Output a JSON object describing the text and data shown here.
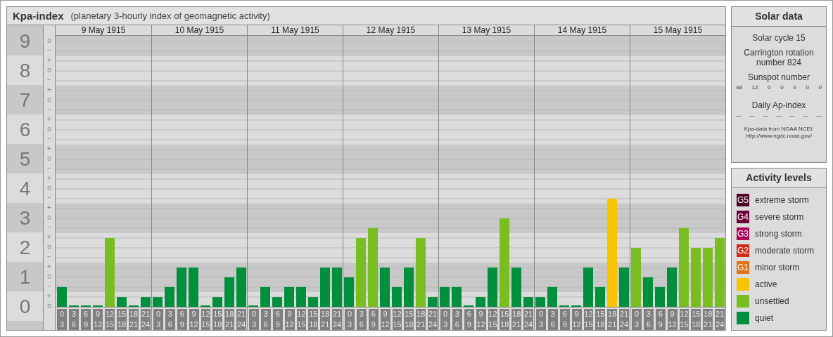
{
  "kp_panel": {
    "title": "Kpa-index",
    "subtitle": "(planetary 3-hourly index of geomagnetic activity)",
    "axis_marks": [
      [
        "o",
        "−"
      ],
      [
        "+",
        "o",
        "−"
      ],
      [
        "+",
        "o",
        "−"
      ],
      [
        "+",
        "o",
        "−"
      ],
      [
        "+",
        "o",
        "−"
      ],
      [
        "+",
        "o",
        "−"
      ],
      [
        "+",
        "o",
        "−"
      ],
      [
        "+",
        "o",
        "−"
      ],
      [
        "+",
        "o",
        "−"
      ],
      [
        "+",
        "o"
      ]
    ],
    "days": [
      {
        "label": "9 May 1915",
        "slots": [
          {
            "start": "0",
            "end": "3"
          },
          {
            "start": "3",
            "end": "6"
          },
          {
            "start": "6",
            "end": "9"
          },
          {
            "start": "9",
            "end": "12"
          },
          {
            "start": "12",
            "end": "15"
          },
          {
            "start": "15",
            "end": "18"
          },
          {
            "start": "18",
            "end": "21"
          },
          {
            "start": "21",
            "end": "24"
          }
        ]
      },
      {
        "label": "10 May 1915",
        "slots": [
          {
            "start": "0",
            "end": "3"
          },
          {
            "start": "3",
            "end": "6"
          },
          {
            "start": "6",
            "end": "9"
          },
          {
            "start": "9",
            "end": "12"
          },
          {
            "start": "12",
            "end": "15"
          },
          {
            "start": "15",
            "end": "18"
          },
          {
            "start": "18",
            "end": "21"
          },
          {
            "start": "21",
            "end": "24"
          }
        ]
      },
      {
        "label": "11 May 1915",
        "slots": [
          {
            "start": "0",
            "end": "3"
          },
          {
            "start": "3",
            "end": "6"
          },
          {
            "start": "6",
            "end": "9"
          },
          {
            "start": "9",
            "end": "12"
          },
          {
            "start": "12",
            "end": "15"
          },
          {
            "start": "15",
            "end": "18"
          },
          {
            "start": "18",
            "end": "21"
          },
          {
            "start": "21",
            "end": "24"
          }
        ]
      },
      {
        "label": "12 May 1915",
        "slots": [
          {
            "start": "0",
            "end": "3"
          },
          {
            "start": "3",
            "end": "6"
          },
          {
            "start": "6",
            "end": "9"
          },
          {
            "start": "9",
            "end": "12"
          },
          {
            "start": "12",
            "end": "15"
          },
          {
            "start": "15",
            "end": "18"
          },
          {
            "start": "18",
            "end": "21"
          },
          {
            "start": "21",
            "end": "24"
          }
        ]
      },
      {
        "label": "13 May 1915",
        "slots": [
          {
            "start": "0",
            "end": "3"
          },
          {
            "start": "3",
            "end": "6"
          },
          {
            "start": "6",
            "end": "9"
          },
          {
            "start": "9",
            "end": "12"
          },
          {
            "start": "12",
            "end": "15"
          },
          {
            "start": "15",
            "end": "18"
          },
          {
            "start": "18",
            "end": "21"
          },
          {
            "start": "21",
            "end": "24"
          }
        ]
      },
      {
        "label": "14 May 1915",
        "slots": [
          {
            "start": "0",
            "end": "3"
          },
          {
            "start": "3",
            "end": "6"
          },
          {
            "start": "6",
            "end": "9"
          },
          {
            "start": "9",
            "end": "12"
          },
          {
            "start": "12",
            "end": "15"
          },
          {
            "start": "15",
            "end": "18"
          },
          {
            "start": "18",
            "end": "21"
          },
          {
            "start": "21",
            "end": "24"
          }
        ]
      },
      {
        "label": "15 May 1915",
        "slots": [
          {
            "start": "0",
            "end": "3"
          },
          {
            "start": "3",
            "end": "6"
          },
          {
            "start": "6",
            "end": "9"
          },
          {
            "start": "9",
            "end": "12"
          },
          {
            "start": "12",
            "end": "15"
          },
          {
            "start": "15",
            "end": "18"
          },
          {
            "start": "18",
            "end": "21"
          },
          {
            "start": "21",
            "end": "24"
          }
        ]
      }
    ],
    "chart_data": {
      "type": "bar",
      "grid": true,
      "ylim": [
        0,
        9.19
      ],
      "yticks": [
        {
          "value": 0,
          "label": "0"
        },
        {
          "value": 1,
          "label": "1"
        },
        {
          "value": 2,
          "label": "2"
        },
        {
          "value": 3,
          "label": "3"
        },
        {
          "value": 4,
          "label": "4"
        },
        {
          "value": 5,
          "label": "5"
        },
        {
          "value": 6,
          "label": "6"
        },
        {
          "value": 7,
          "label": "7"
        },
        {
          "value": 8,
          "label": "8"
        },
        {
          "value": 9,
          "label": "9"
        }
      ],
      "series": [
        {
          "color": "#008f3c",
          "values": [
            0.67,
            0,
            0,
            0,
            null,
            0.33,
            0,
            0.33,
            0.33,
            0.67,
            1.33,
            1.33,
            0,
            0.33,
            1,
            1.33,
            0,
            0.67,
            0.33,
            0.67,
            0.67,
            0.33,
            1.33,
            1.33,
            1,
            null,
            null,
            1.33,
            0.67,
            1.33,
            null,
            0.33,
            0.67,
            0.67,
            0,
            0.33,
            1.33,
            null,
            1.33,
            0.33,
            0.33,
            0.67,
            0,
            0,
            1.33,
            0.67,
            null,
            1.33,
            null,
            1,
            0.67,
            1.33,
            null,
            null,
            null,
            null
          ]
        },
        {
          "color": "#78be20",
          "values": [
            null,
            null,
            null,
            null,
            2.33,
            null,
            null,
            null,
            null,
            null,
            null,
            null,
            null,
            null,
            null,
            null,
            null,
            null,
            null,
            null,
            null,
            null,
            null,
            null,
            null,
            2.33,
            2.67,
            null,
            null,
            null,
            2.33,
            null,
            null,
            null,
            null,
            null,
            null,
            3,
            null,
            null,
            null,
            null,
            null,
            null,
            null,
            null,
            null,
            null,
            2,
            null,
            null,
            null,
            2.67,
            2,
            2,
            2.33
          ]
        },
        {
          "color": "#f8c300",
          "values": [
            null,
            null,
            null,
            null,
            null,
            null,
            null,
            null,
            null,
            null,
            null,
            null,
            null,
            null,
            null,
            null,
            null,
            null,
            null,
            null,
            null,
            null,
            null,
            null,
            null,
            null,
            null,
            null,
            null,
            null,
            null,
            null,
            null,
            null,
            null,
            null,
            null,
            null,
            null,
            null,
            null,
            null,
            null,
            null,
            null,
            null,
            3.67,
            null,
            null,
            null,
            null,
            null,
            null,
            null,
            null,
            null
          ]
        }
      ]
    }
  },
  "solar_data": {
    "title": "Solar data",
    "cycle": "Solar cycle 15",
    "rotation": "Carrington rotation number 824",
    "sunspot_title": "Sunspot number",
    "sunspot_values": [
      "48",
      "12",
      "0",
      "0",
      "0",
      "0",
      "0"
    ],
    "ap_title": "Daily Ap-index",
    "ap_values": [
      "—",
      "—",
      "—",
      "—",
      "—",
      "—",
      "—"
    ],
    "source": "Kpa-data from NOAA NCEI:",
    "source_url": "http://www.ngdc.noaa.gov/"
  },
  "activity_levels": {
    "title": "Activity levels",
    "items": [
      {
        "badge": "G5",
        "label": "extreme storm",
        "color": "#4a0028"
      },
      {
        "badge": "G4",
        "label": "severe storm",
        "color": "#6c0038"
      },
      {
        "badge": "G3",
        "label": "strong storm",
        "color": "#b0005c"
      },
      {
        "badge": "G2",
        "label": "moderate storm",
        "color": "#d42a1c"
      },
      {
        "badge": "G1",
        "label": "minor storm",
        "color": "#e07218"
      },
      {
        "label": "active",
        "color": "#f8c300"
      },
      {
        "label": "unsettled",
        "color": "#78be20"
      },
      {
        "label": "quiet",
        "color": "#008f3c"
      }
    ]
  }
}
